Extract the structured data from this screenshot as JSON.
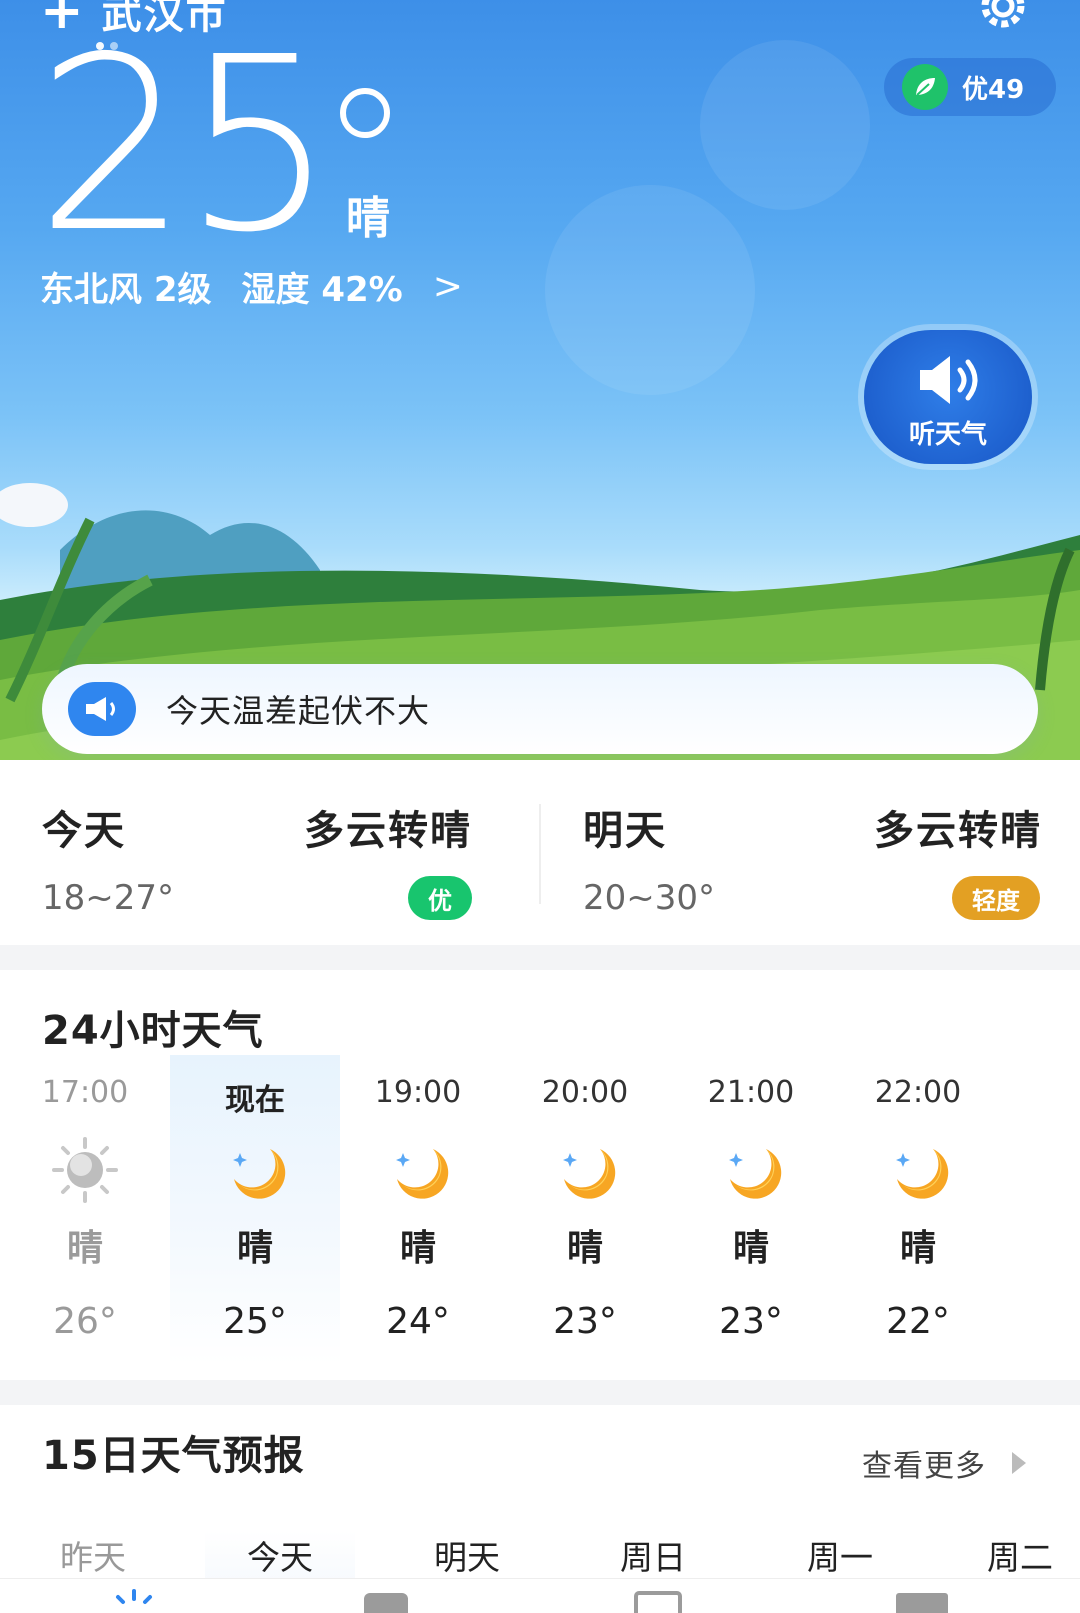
{
  "header": {
    "add_icon": "plus-icon",
    "city": "武汉市",
    "settings_icon": "gear-icon",
    "aqi": {
      "label": "优",
      "value": "49",
      "text": "优49",
      "color": "#1fc26a"
    }
  },
  "current": {
    "temperature": "25",
    "condition": "晴",
    "wind": "东北风 2级",
    "humidity": "湿度 42%",
    "listen_label": "听天气"
  },
  "notice": {
    "text": "今天温差起伏不大"
  },
  "days": [
    {
      "name": "今天",
      "condition": "多云转晴",
      "range": "18~27°",
      "air": "优",
      "air_color": "#18c56e"
    },
    {
      "name": "明天",
      "condition": "多云转晴",
      "range": "20~30°",
      "air": "轻度",
      "air_color": "#e3a023"
    }
  ],
  "hourly": {
    "title": "24小时天气",
    "items": [
      {
        "time": "17:00",
        "icon": "sun-icon",
        "condition": "晴",
        "temp": "26°"
      },
      {
        "time": "现在",
        "icon": "moon-icon",
        "condition": "晴",
        "temp": "25°"
      },
      {
        "time": "19:00",
        "icon": "moon-icon",
        "condition": "晴",
        "temp": "24°"
      },
      {
        "time": "20:00",
        "icon": "moon-icon",
        "condition": "晴",
        "temp": "23°"
      },
      {
        "time": "21:00",
        "icon": "moon-icon",
        "condition": "晴",
        "temp": "23°"
      },
      {
        "time": "22:00",
        "icon": "moon-icon",
        "condition": "晴",
        "temp": "22°"
      }
    ]
  },
  "forecast": {
    "title": "15日天气预报",
    "more": "查看更多",
    "tabs": [
      "昨天",
      "今天",
      "明天",
      "周日",
      "周一",
      "周二"
    ]
  }
}
